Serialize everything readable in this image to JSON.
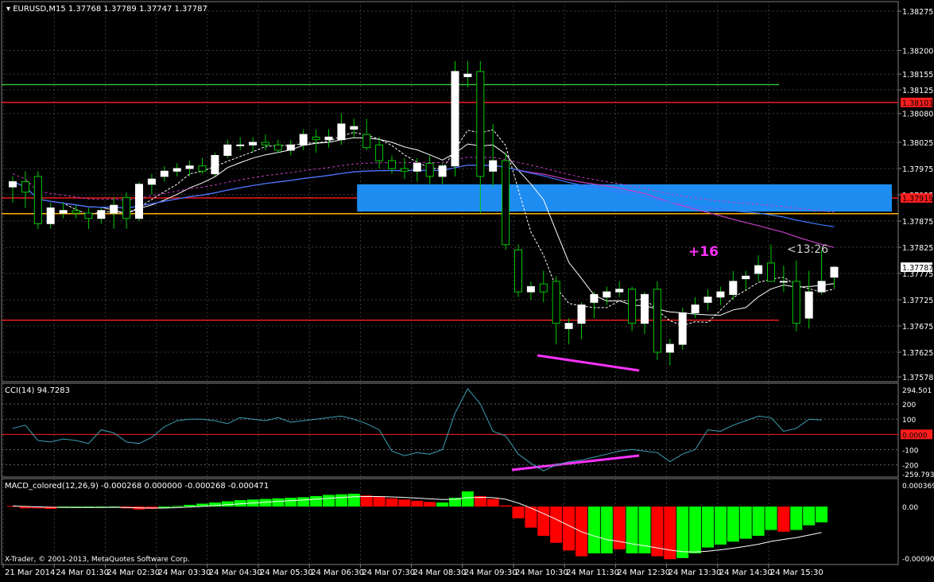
{
  "header": {
    "symbol": "EURUSD,M15",
    "ohlc": "1.37768 1.37789 1.37747 1.37787"
  },
  "annotations": {
    "pips": "+16",
    "timer": "<13:26"
  },
  "cci_label": "CCI(14) 94.7283",
  "macd_label": "MACD_colored(12,26,9) -0.000268 0.000000 -0.000268 -0.000471",
  "copyright": "X-Trader, © 2001-2013, MetaQuotes Software Corp.",
  "colors": {
    "bg": "#000000",
    "grid": "#3a3a3a",
    "bull_body": "#ffffff",
    "bear_body": "#000000",
    "wick": "#00c800",
    "ma_fast": "#ffffff",
    "ma_purple": "#c83cc8",
    "ma_blue": "#3c78ff",
    "zone": "#1e8cf0",
    "green_line": "#32c832",
    "red_line": "#ff1e1e",
    "orange_line": "#ffb400",
    "divergence": "#ff32ff",
    "cci_line": "#3ca0b4",
    "macd_up": "#00ff00",
    "macd_down": "#ff0000"
  },
  "chart_data": [
    {
      "type": "candlestick",
      "ylim": [
        1.37578,
        1.38275
      ],
      "price_labels": [
        "1.38275",
        "1.38200",
        "1.38155",
        "1.38125",
        "1.38101",
        "1.38080",
        "1.38025",
        "1.37975",
        "1.37925",
        "1.37919",
        "1.37875",
        "1.37825",
        "1.37787",
        "1.37775",
        "1.37725",
        "1.37675",
        "1.37625",
        "1.37578"
      ],
      "x_labels": [
        "21 Mar 2014",
        "24 Mar 01:30",
        "24 Mar 02:30",
        "24 Mar 03:30",
        "24 Mar 04:30",
        "24 Mar 05:30",
        "24 Mar 06:30",
        "24 Mar 07:30",
        "24 Mar 08:30",
        "24 Mar 09:30",
        "24 Mar 10:30",
        "24 Mar 11:30",
        "24 Mar 12:30",
        "24 Mar 13:30",
        "24 Mar 14:30",
        "24 Mar 15:30"
      ],
      "horizontal_levels": [
        {
          "price": 1.38135,
          "color": "#32c832"
        },
        {
          "price": 1.38101,
          "color": "#ff1e1e"
        },
        {
          "price": 1.37919,
          "color": "#ff1e1e"
        },
        {
          "price": 1.37889,
          "color": "#ffb400"
        },
        {
          "price": 1.37686,
          "color": "#ff1e1e"
        }
      ],
      "zone": {
        "top": 1.37945,
        "bottom": 1.37893,
        "start_index": 28
      },
      "candles": [
        [
          1.3794,
          1.3796,
          1.3791,
          1.3795
        ],
        [
          1.3795,
          1.3797,
          1.379,
          1.3793
        ],
        [
          1.3796,
          1.3797,
          1.3786,
          1.3787
        ],
        [
          1.3787,
          1.3791,
          1.3786,
          1.379
        ],
        [
          1.3789,
          1.3791,
          1.3788,
          1.37895
        ],
        [
          1.37895,
          1.37905,
          1.3788,
          1.3789
        ],
        [
          1.3789,
          1.379,
          1.3786,
          1.3788
        ],
        [
          1.3788,
          1.379,
          1.3787,
          1.37895
        ],
        [
          1.3789,
          1.3792,
          1.3786,
          1.37905
        ],
        [
          1.3792,
          1.3793,
          1.3786,
          1.3788
        ],
        [
          1.3788,
          1.3795,
          1.37875,
          1.37945
        ],
        [
          1.37945,
          1.37965,
          1.37925,
          1.37955
        ],
        [
          1.3796,
          1.3798,
          1.3795,
          1.3797
        ],
        [
          1.3797,
          1.37985,
          1.3796,
          1.37975
        ],
        [
          1.37975,
          1.3799,
          1.3796,
          1.3798
        ],
        [
          1.3798,
          1.37995,
          1.37965,
          1.3797
        ],
        [
          1.37965,
          1.38005,
          1.3796,
          1.38
        ],
        [
          1.38,
          1.3803,
          1.37995,
          1.3802
        ],
        [
          1.3802,
          1.38035,
          1.3801,
          1.3802
        ],
        [
          1.3802,
          1.38035,
          1.38005,
          1.38025
        ],
        [
          1.38025,
          1.3804,
          1.3801,
          1.3802
        ],
        [
          1.3802,
          1.3803,
          1.38005,
          1.3801
        ],
        [
          1.3801,
          1.3803,
          1.38,
          1.3802
        ],
        [
          1.3802,
          1.3805,
          1.3801,
          1.3804
        ],
        [
          1.38035,
          1.3805,
          1.38005,
          1.3803
        ],
        [
          1.3803,
          1.3805,
          1.38015,
          1.38035
        ],
        [
          1.3803,
          1.3808,
          1.3802,
          1.3806
        ],
        [
          1.3805,
          1.3807,
          1.38035,
          1.38055
        ],
        [
          1.3804,
          1.3807,
          1.3801,
          1.38015
        ],
        [
          1.3802,
          1.38035,
          1.37975,
          1.3799
        ],
        [
          1.3799,
          1.38,
          1.37965,
          1.37975
        ],
        [
          1.37975,
          1.37995,
          1.37955,
          1.3797
        ],
        [
          1.3797,
          1.37995,
          1.3795,
          1.37985
        ],
        [
          1.37985,
          1.38,
          1.37945,
          1.3796
        ],
        [
          1.3796,
          1.37985,
          1.37945,
          1.3798
        ],
        [
          1.3798,
          1.3818,
          1.3796,
          1.3816
        ],
        [
          1.3815,
          1.3818,
          1.3813,
          1.38155
        ],
        [
          1.3816,
          1.3818,
          1.3789,
          1.3796
        ],
        [
          1.3797,
          1.3806,
          1.3794,
          1.3799
        ],
        [
          1.3799,
          1.38005,
          1.3782,
          1.3783
        ],
        [
          1.3782,
          1.3783,
          1.3773,
          1.3774
        ],
        [
          1.3774,
          1.3776,
          1.37725,
          1.3775
        ],
        [
          1.37755,
          1.3778,
          1.3772,
          1.3774
        ],
        [
          1.3776,
          1.3777,
          1.3764,
          1.3768
        ],
        [
          1.3767,
          1.3769,
          1.3764,
          1.3768
        ],
        [
          1.3768,
          1.3772,
          1.3765,
          1.37715
        ],
        [
          1.3772,
          1.3774,
          1.3769,
          1.37735
        ],
        [
          1.3773,
          1.3775,
          1.37715,
          1.3774
        ],
        [
          1.3774,
          1.3776,
          1.3773,
          1.37745
        ],
        [
          1.37745,
          1.3775,
          1.37665,
          1.3768
        ],
        [
          1.3768,
          1.3774,
          1.3766,
          1.37735
        ],
        [
          1.37745,
          1.3776,
          1.3761,
          1.37625
        ],
        [
          1.37625,
          1.3765,
          1.376,
          1.3764
        ],
        [
          1.3764,
          1.3771,
          1.3763,
          1.377
        ],
        [
          1.377,
          1.3773,
          1.3769,
          1.37715
        ],
        [
          1.3772,
          1.37745,
          1.37705,
          1.3773
        ],
        [
          1.3773,
          1.3775,
          1.37715,
          1.3774
        ],
        [
          1.37735,
          1.3778,
          1.37725,
          1.3776
        ],
        [
          1.37765,
          1.3778,
          1.37745,
          1.3777
        ],
        [
          1.37775,
          1.3781,
          1.3776,
          1.3779
        ],
        [
          1.37795,
          1.3783,
          1.3777,
          1.3776
        ],
        [
          1.3776,
          1.3779,
          1.3774,
          1.3776
        ],
        [
          1.3776,
          1.378,
          1.37665,
          1.3768
        ],
        [
          1.3769,
          1.3778,
          1.3767,
          1.3774
        ],
        [
          1.3774,
          1.3782,
          1.37735,
          1.3776
        ],
        [
          1.37768,
          1.37789,
          1.37747,
          1.37787
        ]
      ]
    },
    {
      "type": "line",
      "name": "CCI(14)",
      "ylim": [
        -259.7935,
        294.501
      ],
      "y_labels": [
        "294.501",
        "200",
        "100",
        "0.0000",
        "-100",
        "-200",
        "-259.7935"
      ],
      "values": [
        40,
        60,
        -40,
        -50,
        -30,
        -40,
        -60,
        30,
        10,
        -50,
        -60,
        -20,
        50,
        90,
        100,
        100,
        90,
        70,
        110,
        100,
        90,
        110,
        80,
        90,
        100,
        110,
        120,
        100,
        70,
        30,
        -110,
        -140,
        -120,
        -130,
        -100,
        140,
        300,
        200,
        20,
        -10,
        -130,
        -190,
        -240,
        -200,
        -180,
        -170,
        -150,
        -130,
        -110,
        -100,
        -110,
        -120,
        -180,
        -130,
        -100,
        30,
        20,
        60,
        90,
        120,
        110,
        20,
        40,
        100,
        95
      ]
    },
    {
      "type": "bar",
      "name": "MACD_colored(12,26,9)",
      "ylim": [
        -0.000909,
        0.000369
      ],
      "y_labels": [
        "0.000369",
        "0.00",
        "-0.000909"
      ],
      "values": [
        1e-05,
        -3e-05,
        -3e-05,
        -4e-05,
        -2e-05,
        -2e-05,
        -2e-05,
        -1e-05,
        0.0,
        -3e-05,
        -5e-05,
        -4e-05,
        -2e-05,
        1e-05,
        3e-05,
        5e-05,
        7e-05,
        9e-05,
        0.00011,
        0.00012,
        0.00013,
        0.00014,
        0.00015,
        0.00016,
        0.00018,
        0.0002,
        0.00021,
        0.00022,
        0.00019,
        0.00017,
        0.00014,
        0.00012,
        0.0001,
        8e-05,
        7e-05,
        0.00015,
        0.00026,
        0.00018,
        0.00013,
        2e-05,
        -0.0002,
        -0.00036,
        -0.0005,
        -0.00062,
        -0.00075,
        -0.00085,
        -0.0008,
        -0.0008,
        -0.00073,
        -0.0008,
        -0.0008,
        -0.00085,
        -0.0009,
        -0.00088,
        -0.0008,
        -0.0007,
        -0.00065,
        -0.0006,
        -0.00055,
        -0.0005,
        -0.0004,
        -0.00043,
        -0.0004,
        -0.00032,
        -0.00027
      ],
      "colors": [
        "down",
        "down",
        "down",
        "down",
        "up",
        "up",
        "up",
        "up",
        "up",
        "down",
        "down",
        "down",
        "up",
        "up",
        "up",
        "up",
        "up",
        "up",
        "up",
        "up",
        "up",
        "up",
        "up",
        "up",
        "up",
        "up",
        "up",
        "up",
        "down",
        "down",
        "down",
        "down",
        "down",
        "down",
        "up",
        "up",
        "up",
        "down",
        "down",
        "down",
        "down",
        "down",
        "down",
        "down",
        "down",
        "down",
        "up",
        "up",
        "down",
        "up",
        "up",
        "down",
        "down",
        "up",
        "up",
        "up",
        "up",
        "up",
        "up",
        "up",
        "up",
        "down",
        "up",
        "up",
        "up"
      ]
    }
  ]
}
